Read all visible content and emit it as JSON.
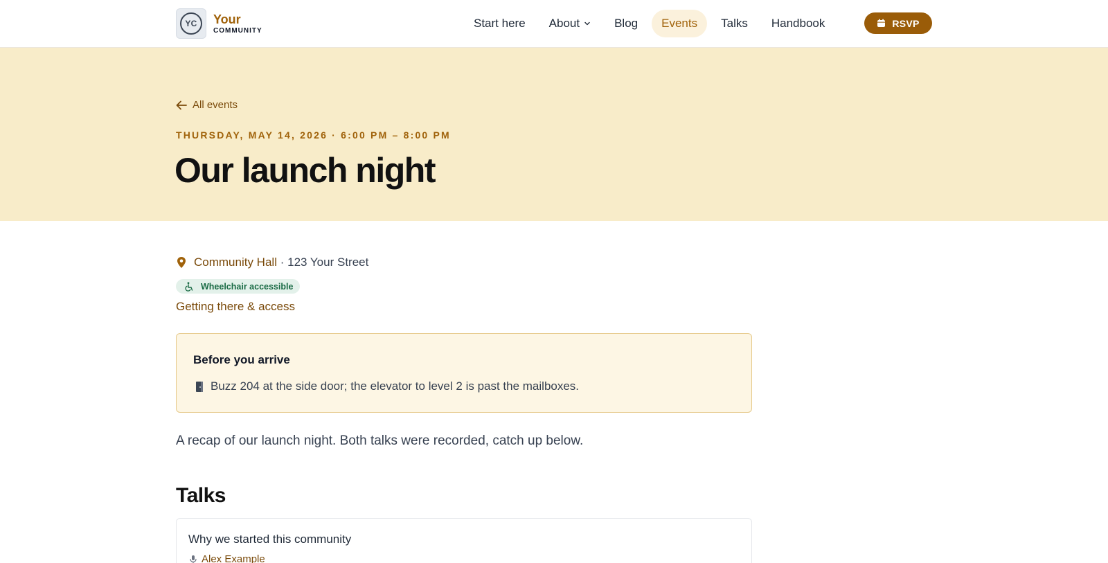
{
  "brand": {
    "initials": "YC",
    "name_top": "Your",
    "name_bottom": "COMMUNITY"
  },
  "nav": {
    "items": [
      {
        "label": "Start here"
      },
      {
        "label": "About"
      },
      {
        "label": "Blog"
      },
      {
        "label": "Events",
        "active": true
      },
      {
        "label": "Talks"
      },
      {
        "label": "Handbook"
      }
    ],
    "cta_label": "RSVP"
  },
  "hero": {
    "back_label": "All events",
    "datetime": "THURSDAY, MAY 14, 2026 · 6:00 PM – 8:00 PM",
    "title": "Our launch night"
  },
  "event": {
    "venue": "Community Hall",
    "separator": "·",
    "address": "123 Your Street",
    "accessibility_badge": "Wheelchair accessible",
    "access_link": "Getting there & access",
    "notice": {
      "title": "Before you arrive",
      "body": "Buzz 204 at the side door; the elevator to level 2 is past the mailboxes."
    },
    "description": "A recap of our launch night. Both talks were recorded, catch up below."
  },
  "talks": {
    "heading": "Talks",
    "items": [
      {
        "title": "Why we started this community",
        "speaker": "Alex Example"
      }
    ]
  },
  "colors": {
    "accent": "#a0620a",
    "hero_bg": "#f8ecc9",
    "button_bg": "#9a5c08",
    "badge_bg": "#e3f1ea",
    "badge_text": "#1a6b45",
    "notice_bg": "#fdf6e4",
    "notice_border": "#e6c98a"
  },
  "icons": [
    "logo-badge",
    "chevron-down-icon",
    "calendar-icon",
    "arrow-left-icon",
    "map-pin-icon",
    "wheelchair-icon",
    "door-icon",
    "microphone-icon"
  ]
}
